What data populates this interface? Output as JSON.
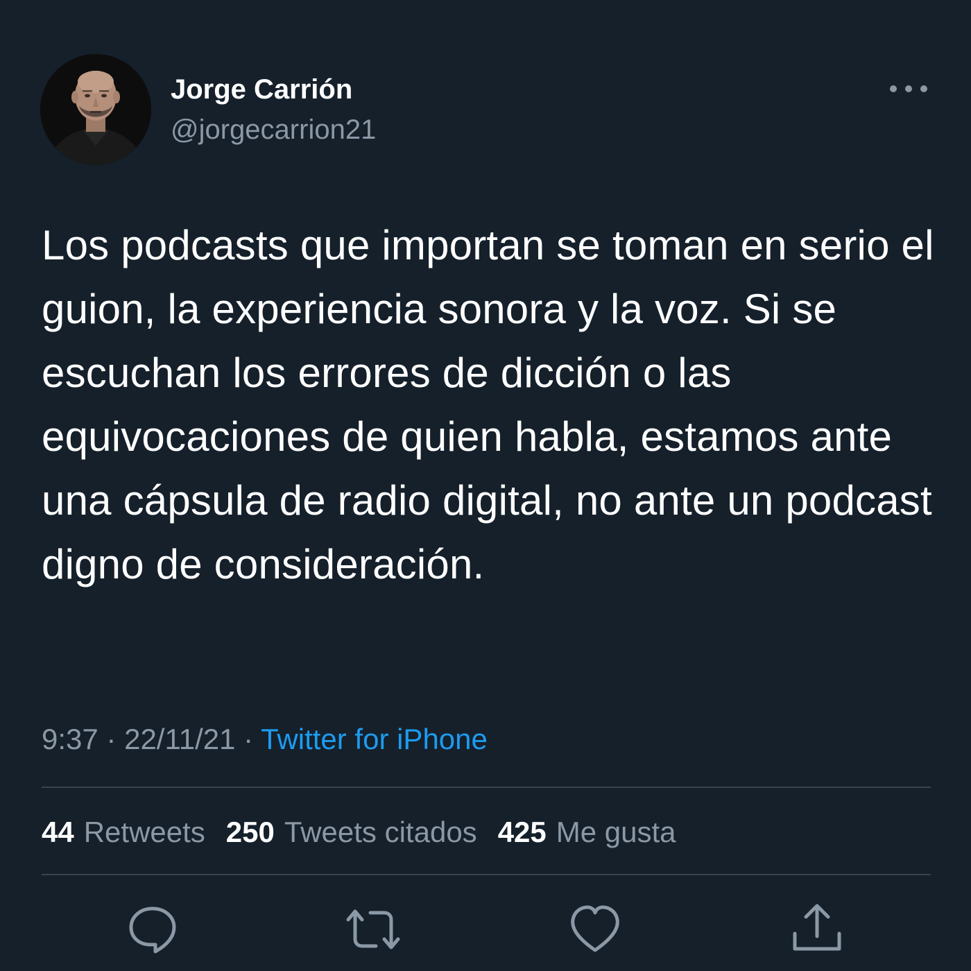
{
  "tweet": {
    "author": {
      "name": "Jorge Carrión",
      "handle": "@jorgecarrion21"
    },
    "text": "Los podcasts que importan se toman en serio el guion, la experiencia sonora y la voz. Si se escuchan los errores de dicción o las equivocaciones de quien habla, estamos ante una cápsula de radio digital, no ante un podcast digno de consideración.",
    "time": "9:37",
    "separator": "·",
    "date": "22/11/21",
    "source": "Twitter for iPhone",
    "stats": {
      "retweets_count": "44",
      "retweets_label": "Retweets",
      "quotes_count": "250",
      "quotes_label": "Tweets citados",
      "likes_count": "425",
      "likes_label": "Me gusta"
    },
    "actions": {
      "reply_icon": "speech-bubble-icon",
      "retweet_icon": "retweet-arrows-icon",
      "like_icon": "heart-icon",
      "share_icon": "share-upload-icon"
    },
    "more_icon": "ellipsis-icon"
  },
  "colors": {
    "background": "#15202b",
    "text_primary": "#ffffff",
    "text_secondary": "#8b98a5",
    "accent": "#1d9bf0",
    "divider": "#38444d"
  }
}
